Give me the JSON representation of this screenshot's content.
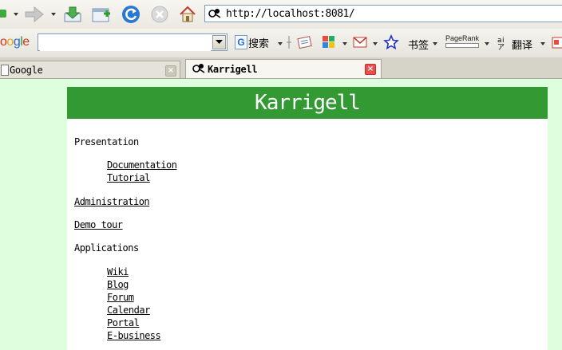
{
  "toolbar": {
    "address": "http://localhost:8081/"
  },
  "search_toolbar": {
    "logo": "oogle",
    "search_value": "",
    "search_button_label": "G搜索",
    "bookmarks_label": "书签",
    "pagerank_label": "PageRank",
    "translate_label": "翻译"
  },
  "tabs": [
    {
      "title": "Google",
      "active": false
    },
    {
      "title": "Karrigell",
      "active": true
    }
  ],
  "page": {
    "banner_title": "Karrigell",
    "presentation": "Presentation",
    "documentation": "Documentation",
    "tutorial": "Tutorial",
    "administration": "Administration",
    "demo_tour": "Demo tour",
    "applications": "Applications",
    "apps": [
      "Wiki",
      "Blog",
      "Forum",
      "Calendar",
      "Portal",
      "E-business"
    ]
  },
  "colors": {
    "banner_bg": "#339933",
    "page_bg": "#ddffdd"
  }
}
